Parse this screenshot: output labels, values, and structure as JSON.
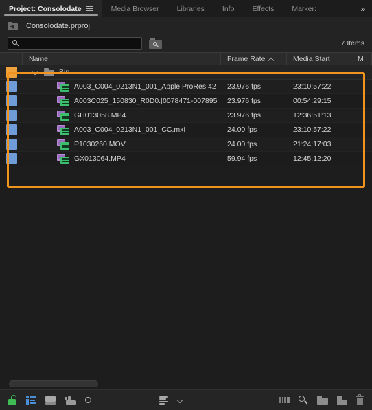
{
  "window": {
    "accent_orange": "#f0941e",
    "panel_bg": "#232323",
    "list_bg": "#1d1d1d"
  },
  "tabs": [
    {
      "label": "Project: Consolodate",
      "active": true,
      "menu_icon": "hamburger-menu-icon"
    },
    {
      "label": "Media Browser",
      "active": false
    },
    {
      "label": "Libraries",
      "active": false
    },
    {
      "label": "Info",
      "active": false
    },
    {
      "label": "Effects",
      "active": false
    },
    {
      "label": "Marker:",
      "active": false
    }
  ],
  "tab_overflow_label": "»",
  "breadcrumb": {
    "up_icon": "navigate-up-folder-icon",
    "project_name": "Consolodate.prproj"
  },
  "search": {
    "value": "",
    "placeholder": "",
    "icon": "search-icon",
    "find_bin_icon": "find-in-bin-icon"
  },
  "item_count": "7 Items",
  "columns": [
    {
      "key": "swatch",
      "label": ""
    },
    {
      "key": "name",
      "label": "Name"
    },
    {
      "key": "frame_rate",
      "label": "Frame Rate",
      "sorted": "asc"
    },
    {
      "key": "media_start",
      "label": "Media Start"
    },
    {
      "key": "more",
      "label": "M"
    }
  ],
  "rows": [
    {
      "type": "bin",
      "label_color": "#efa23c",
      "expanded": true,
      "icon": "folder-icon",
      "name": "Bin",
      "frame_rate": "",
      "media_start": ""
    },
    {
      "type": "clip",
      "label_color": "#6f9cd8",
      "icon": "video-clip-icon",
      "name": "A003_C004_0213N1_001_Apple ProRes 42",
      "frame_rate": "23.976 fps",
      "media_start": "23:10:57:22"
    },
    {
      "type": "clip",
      "label_color": "#6f9cd8",
      "icon": "video-clip-icon",
      "name": "A003C025_150830_R0D0.[0078471-007895",
      "frame_rate": "23.976 fps",
      "media_start": "00:54:29:15"
    },
    {
      "type": "clip",
      "label_color": "#6f9cd8",
      "icon": "video-clip-icon",
      "name": "GH013058.MP4",
      "frame_rate": "23.976 fps",
      "media_start": "12:36:51:13"
    },
    {
      "type": "clip",
      "label_color": "#6f9cd8",
      "icon": "video-clip-icon",
      "name": "A003_C004_0213N1_001_CC.mxf",
      "frame_rate": "24.00 fps",
      "media_start": "23:10:57:22"
    },
    {
      "type": "clip",
      "label_color": "#6f9cd8",
      "icon": "video-clip-icon",
      "name": "P1030260.MOV",
      "frame_rate": "24.00 fps",
      "media_start": "21:24:17:03"
    },
    {
      "type": "clip",
      "label_color": "#6f9cd8",
      "icon": "video-clip-icon",
      "name": "GX013064.MP4",
      "frame_rate": "59.94 fps",
      "media_start": "12:45:12:20"
    }
  ],
  "toolbar": {
    "left": [
      {
        "icon": "lock-open-icon",
        "color": "#3fbd55"
      },
      {
        "icon": "list-view-icon",
        "color": "#4a8fd8"
      },
      {
        "icon": "icon-view-icon",
        "color": "#a9a9a9"
      },
      {
        "icon": "freeform-view-icon",
        "color": "#9a9a9a"
      },
      {
        "icon": "zoom-slider",
        "color": "#c0c0c0"
      },
      {
        "icon": "sort-icon",
        "color": "#a8a8a8"
      },
      {
        "icon": "chevron-down-icon",
        "color": "#a0a0a0"
      }
    ],
    "right": [
      {
        "icon": "automate-to-sequence-icon",
        "color": "#7c7c7c"
      },
      {
        "icon": "find-icon",
        "color": "#b8b8b8"
      },
      {
        "icon": "new-bin-icon",
        "color": "#8d8d8d"
      },
      {
        "icon": "new-item-icon",
        "color": "#8d8d8d"
      },
      {
        "icon": "delete-icon",
        "color": "#7e7e7e"
      }
    ]
  }
}
